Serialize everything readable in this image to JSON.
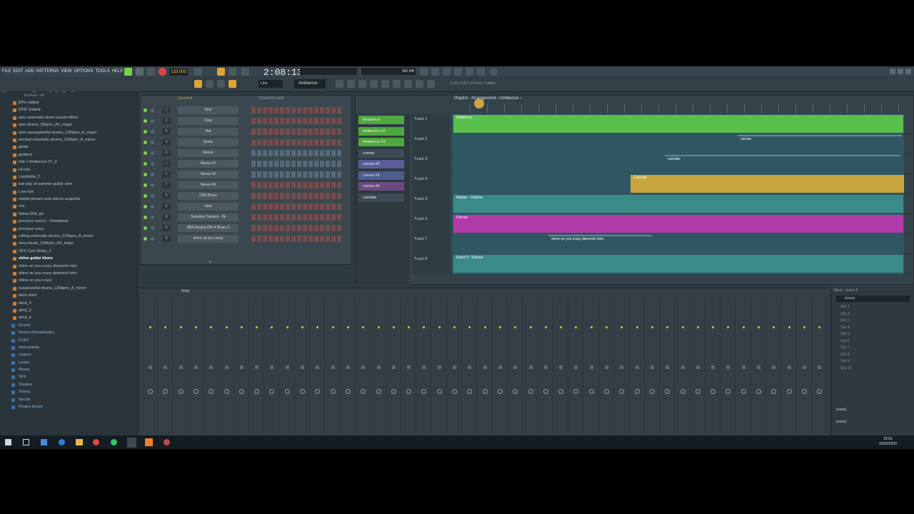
{
  "menu": [
    "FILE",
    "EDIT",
    "ADD",
    "PATTERNS",
    "VIEW",
    "OPTIONS",
    "TOOLS",
    "HELP"
  ],
  "transport": {
    "bpm": "133.000",
    "time": "2:08:13",
    "pattern": "Ambience",
    "snap": "Line",
    "cpu": "386 MB"
  },
  "hint": "Shine on you crazy Diamond #1 - Pink Floyd.flp",
  "browser": {
    "header": "Browser - All",
    "items": [
      "EPic edited",
      "EPIC Edited",
      "epic-cinematic-drum-sound-effect",
      "epic-drums_95bpm_A#_major",
      "epic-sususpeseful-drums_128bpm_A_major",
      "excited-cinematic-drums_110bpm_A_minor",
      "guitar",
      "guitarra",
      "Hat + Ambience 07_2",
      "Hi-tom",
      "Landslide_2",
      "last day of summer guitar core",
      "Low-tom",
      "martin-jensen-solo-dance-acapella",
      "mix",
      "Notas 004_sd",
      "precious voice1 - Downbeat",
      "precious voice",
      "rolling-cinematic-drums_110bpm_A_minor",
      "sexy-beats_130bpm_A#_major",
      "SFX Cym Noisy_2",
      "shine guitar blues",
      "shine on you crazy diamond intro",
      "shine on you crazy diamond intro",
      "shine on you crazy",
      "suspenseful-drums_130bpm_A_minor",
      "wind short",
      "wind_2",
      "wind_3",
      "wind_4"
    ],
    "folders": [
      "Drums",
      "Drums (ModeAudio)",
      "FLEX",
      "Instruments",
      "Legacy",
      "Loops",
      "Risers",
      "SFX",
      "Shapes",
      "Timmy",
      "Vocals",
      "Project bones"
    ]
  },
  "channelrack": {
    "title": "Channel rack",
    "filter": "Unsorted",
    "channels": [
      {
        "num": "1",
        "name": "Kick"
      },
      {
        "num": "2",
        "name": "Clap"
      },
      {
        "num": "3",
        "name": "Hat"
      },
      {
        "num": "4",
        "name": "Snare"
      },
      {
        "num": "5",
        "name": "Nexus"
      },
      {
        "num": "—",
        "name": "Nexus #2"
      },
      {
        "num": "6",
        "name": "Nexus #3"
      },
      {
        "num": "7",
        "name": "Nexus #4"
      },
      {
        "num": "8",
        "name": "DSK Brass"
      },
      {
        "num": "9",
        "name": "oboe"
      },
      {
        "num": "8",
        "name": "Sonatina Trumpet - 8k"
      },
      {
        "num": "8",
        "name": "BBS Analog D8+X Brass 3"
      },
      {
        "num": "8",
        "name": "shine on you crazy"
      }
    ]
  },
  "playlist": {
    "title": "Playlist - Arrangement › Ambience ›",
    "plugin": "11/50 FLEX | Photon Collider",
    "patterns": [
      "Ambience",
      "Ambience #2",
      "Ambience #3",
      "cornos",
      "cornos #2",
      "cornos #3",
      "cornos #4",
      "cuerdas"
    ],
    "tracks": [
      {
        "label": "Track 1",
        "clip": "Ambience",
        "color": "#58c04a"
      },
      {
        "label": "Track 2",
        "clip": "cornos",
        "color": "#2f5662"
      },
      {
        "label": "Track 3",
        "clip": "cuerdas",
        "color": "#2f5662"
      },
      {
        "label": "Track 4",
        "clip": "Cuerdas",
        "color": "#c8a43c"
      },
      {
        "label": "Track 5",
        "clip": "Master - Volume",
        "color": "#3b8a8a"
      },
      {
        "label": "Track 6",
        "clip": "Cornos",
        "color": "#b03aa8"
      },
      {
        "label": "Track 7",
        "clip": "shine on you crazy diamond intro",
        "color": "#2f5662"
      },
      {
        "label": "Track 8",
        "clip": "Insert 9 - Volume",
        "color": "#3b8a8a"
      }
    ]
  },
  "mixer": {
    "title": "Wide",
    "insert": "Mixer - Insert 9",
    "slot_none": "(none)",
    "slots": [
      "Slot 1",
      "Slot 2",
      "Slot 3",
      "Slot 4",
      "Slot 5",
      "Slot 6",
      "Slot 7",
      "Slot 8",
      "Slot 9",
      "Slot 10"
    ]
  },
  "taskbar": {
    "time": "22:52",
    "date": "25/03/2020"
  }
}
